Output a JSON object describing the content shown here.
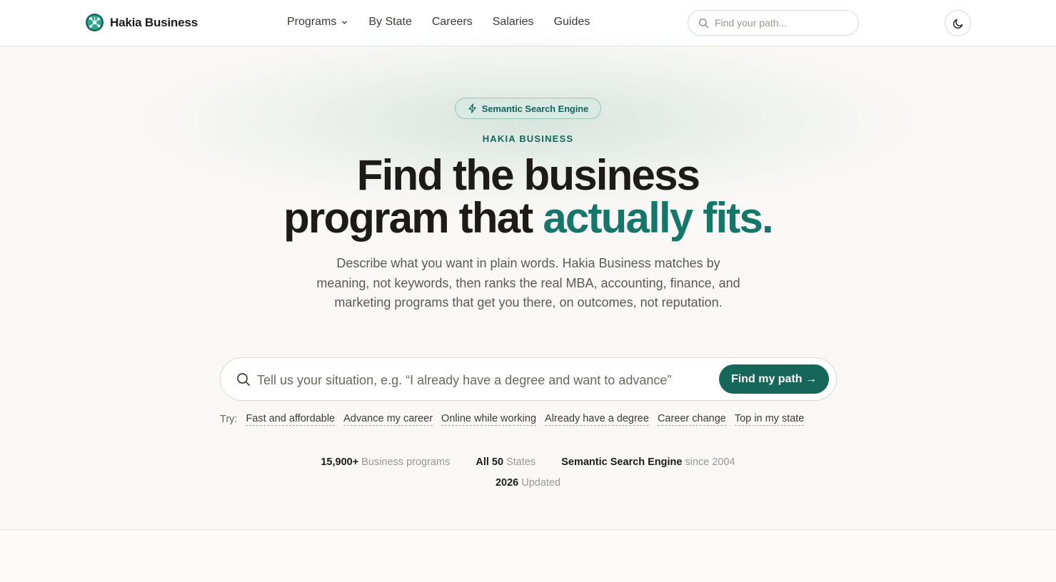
{
  "header": {
    "brand_name": "Hakia Business",
    "nav": [
      {
        "label": "Programs",
        "has_dropdown": true
      },
      {
        "label": "By State"
      },
      {
        "label": "Careers"
      },
      {
        "label": "Salaries"
      },
      {
        "label": "Guides"
      }
    ],
    "search_placeholder": "Find your path...",
    "theme_toggle_icon": "moon-icon"
  },
  "hero": {
    "badge": "Semantic Search Engine",
    "badge_icon": "lightning-icon",
    "eyebrow": "HAKIA BUSINESS",
    "headline_line1": "Find the business",
    "headline_line2_prefix": "program that ",
    "headline_line2_accent": "actually fits.",
    "lede": "Describe what you want in plain words. Hakia Business matches by meaning, not keywords, then ranks the real MBA, accounting, finance, and marketing programs that get you there, on outcomes, not reputation.",
    "search_placeholder": "Tell us your situation, e.g. “I already have a degree and want to advance”",
    "search_button": "Find my path →",
    "try_label": "Try:",
    "suggestions": [
      "Fast and affordable",
      "Advance my career",
      "Online while working",
      "Already have a degree",
      "Career change",
      "Top in my state"
    ],
    "stats": [
      {
        "value": "15,900+",
        "label": "Business programs"
      },
      {
        "value": "All 50",
        "label": "States"
      },
      {
        "value": "Semantic Search Engine",
        "label": "since 2004"
      },
      {
        "value": "2026",
        "label": "Updated"
      }
    ]
  },
  "colors": {
    "accent": "#15766a",
    "button": "#17665a",
    "badge_bg": "#d9e9e3",
    "background": "#faf8f6"
  }
}
